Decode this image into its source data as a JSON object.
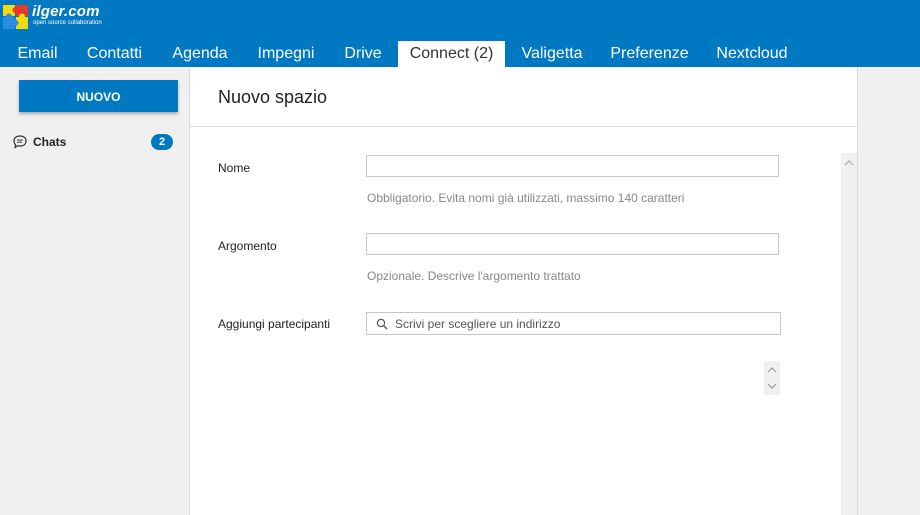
{
  "app": {
    "logo_name": "ilger.com",
    "logo_tagline": "open source collaboration"
  },
  "tabs": [
    {
      "label": "Email"
    },
    {
      "label": "Contatti"
    },
    {
      "label": "Agenda"
    },
    {
      "label": "Impegni"
    },
    {
      "label": "Drive"
    },
    {
      "label": "Connect (2)",
      "active": true
    },
    {
      "label": "Valigetta"
    },
    {
      "label": "Preferenze"
    },
    {
      "label": "Nextcloud"
    }
  ],
  "sidebar": {
    "new_button": "NUOVO",
    "chats_label": "Chats",
    "chats_badge": "2",
    "chats_icon": "chat-bubble-icon"
  },
  "form": {
    "title": "Nuovo spazio",
    "name_label": "Nome",
    "name_value": "",
    "name_hint": "Obbligatorio. Evita nomi già utilizzati, massimo 140 caratteri",
    "topic_label": "Argomento",
    "topic_value": "",
    "topic_hint": "Opzionale. Descrive l'argomento trattato",
    "participants_label": "Aggiungi partecipanti",
    "participants_placeholder": "Scrivi per scegliere un indirizzo"
  },
  "colors": {
    "brand": "#0079c2",
    "sidebar_bg": "#f0f0f0",
    "hint": "#888888"
  }
}
